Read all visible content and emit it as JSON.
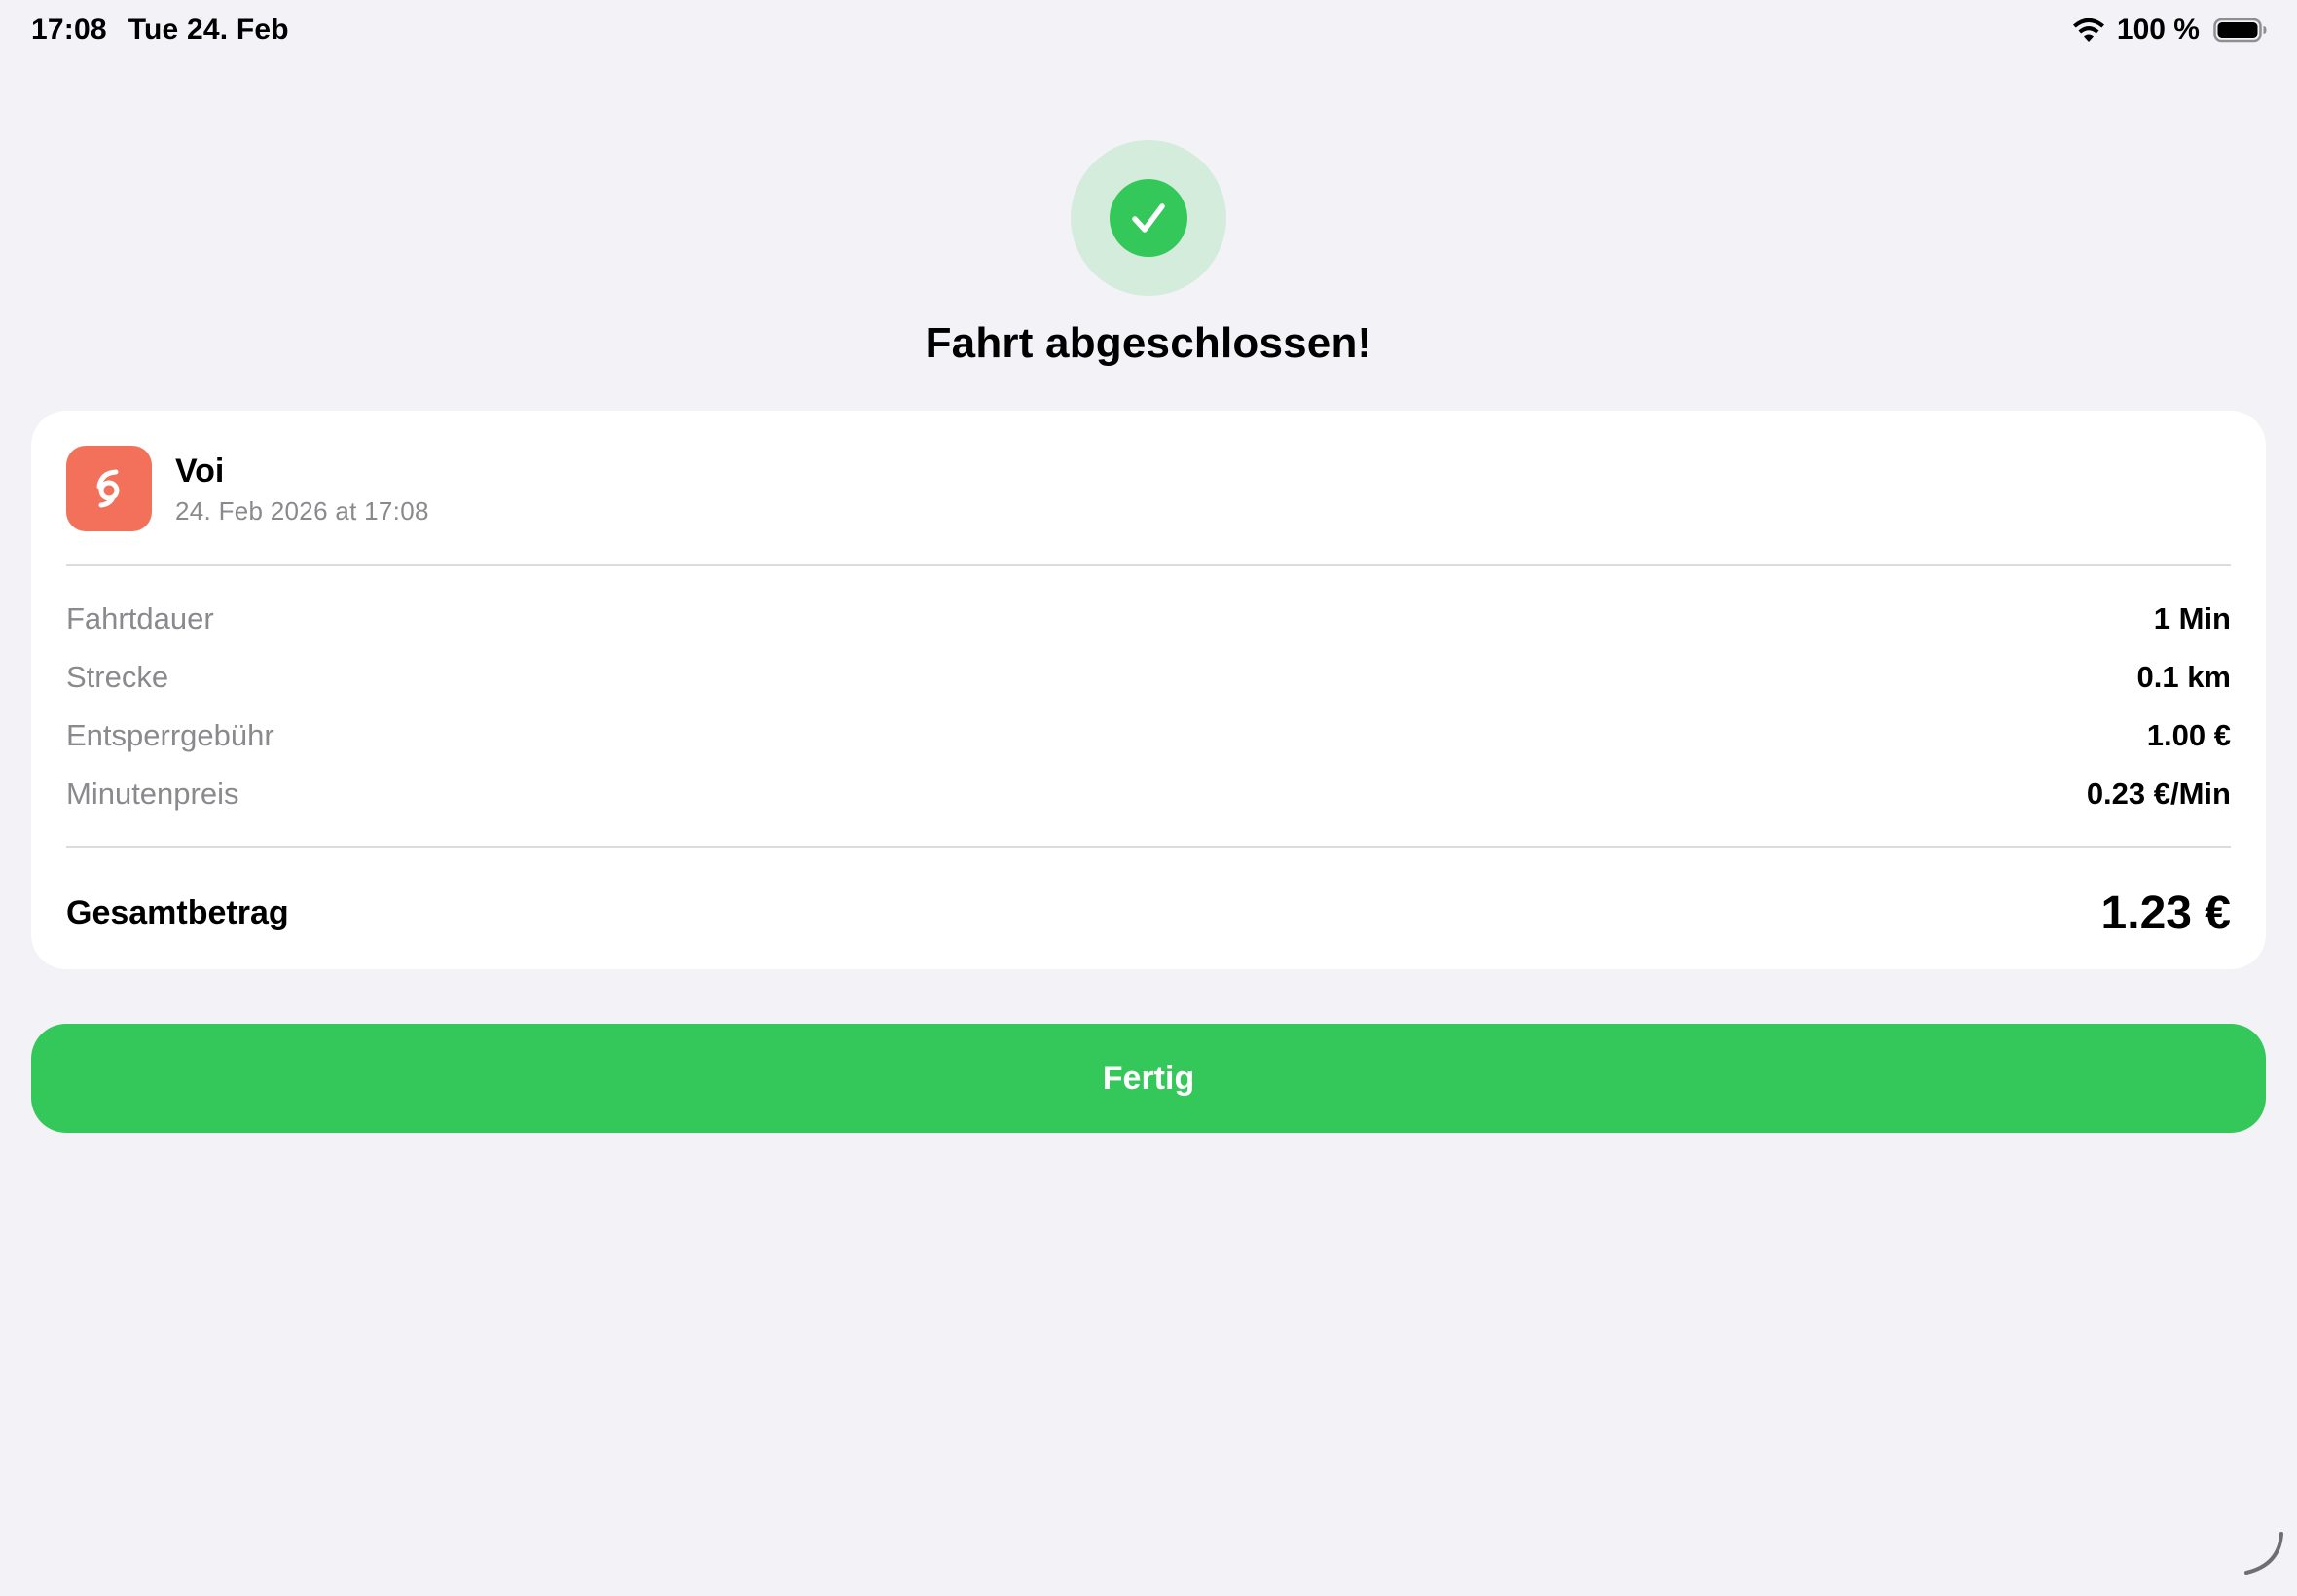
{
  "status_bar": {
    "time": "17:08",
    "date": "Tue 24. Feb",
    "battery": "100 %"
  },
  "header": {
    "title": "Fahrt abgeschlossen!"
  },
  "receipt": {
    "provider": {
      "name": "Voi",
      "date": "24. Feb 2026 at 17:08",
      "brand_color": "#f3715a"
    },
    "details": [
      {
        "label": "Fahrtdauer",
        "value": "1 Min"
      },
      {
        "label": "Strecke",
        "value": "0.1 km"
      },
      {
        "label": "Entsperrgebühr",
        "value": "1.00 €"
      },
      {
        "label": "Minutenpreis",
        "value": "0.23 €/Min"
      }
    ],
    "total": {
      "label": "Gesamtbetrag",
      "value": "1.23 €"
    }
  },
  "actions": {
    "done_label": "Fertig"
  },
  "colors": {
    "accent_green": "#34c759",
    "badge_background": "#d3ecdc",
    "screen_background": "#f2f2f7"
  },
  "icons": [
    "wifi-icon",
    "battery-icon",
    "checkmark-icon",
    "voi-logo-icon",
    "resize-handle-icon"
  ]
}
